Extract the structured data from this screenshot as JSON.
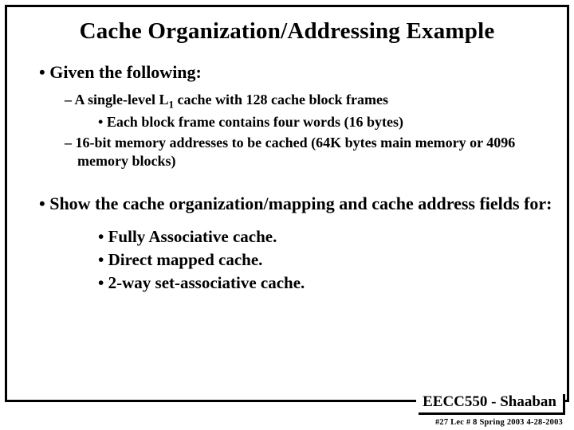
{
  "title": "Cache Organization/Addressing Example",
  "bullets": {
    "given": "Given the following:",
    "g1": "A single-level L",
    "g1_sub": "1",
    "g1_tail": " cache with 128 cache block frames",
    "g1a": "Each block frame contains four words (16 bytes)",
    "g2": "16-bit memory addresses to be cached (64K bytes main memory or 4096 memory blocks)",
    "show": "Show the cache organization/mapping and cache address fields for:",
    "s1": "Fully Associative cache.",
    "s2": "Direct mapped cache.",
    "s3": "2-way set-associative cache."
  },
  "footer": {
    "course": "EECC550 - Shaaban",
    "meta": "#27  Lec # 8   Spring 2003   4-28-2003"
  }
}
